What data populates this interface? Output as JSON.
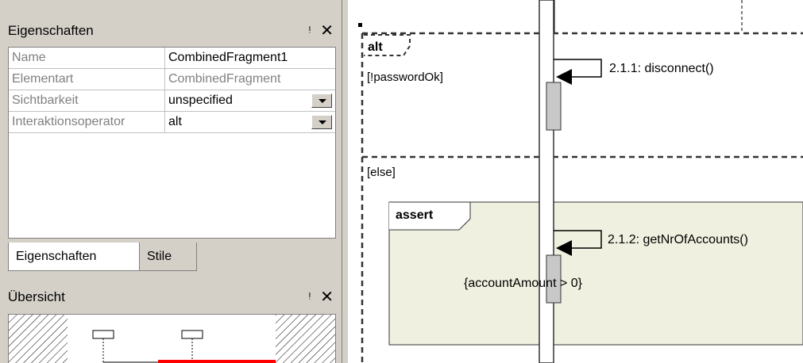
{
  "properties_panel": {
    "title": "Eigenschaften",
    "rows": [
      {
        "name": "Name",
        "value": "CombinedFragment1"
      },
      {
        "name": "Elementart",
        "value": "CombinedFragment"
      },
      {
        "name": "Sichtbarkeit",
        "value": "unspecified"
      },
      {
        "name": "Interaktionsoperator",
        "value": "alt"
      }
    ],
    "tabs": [
      {
        "label": "Eigenschaften",
        "active": true
      },
      {
        "label": "Stile",
        "active": false
      }
    ]
  },
  "overview_panel": {
    "title": "Übersicht"
  },
  "icons": {
    "pin": "pin-icon",
    "close": "close-icon",
    "dropdown": "dropdown-arrow-icon"
  },
  "colors": {
    "panel_bg": "#d4d0c8",
    "assert_fill": "#f0f0e0",
    "activation_fill": "#c8c8c8",
    "overview_highlight": "#ff0000"
  },
  "diagram": {
    "alt_fragment": {
      "operator": "alt",
      "guard_1": "[!passwordOk]",
      "guard_2": "[else]"
    },
    "assert_fragment": {
      "operator": "assert",
      "constraint": "{accountAmount > 0}"
    },
    "messages": [
      {
        "label": "2.1.1: disconnect()"
      },
      {
        "label": "2.1.2: getNrOfAccounts()"
      }
    ]
  }
}
